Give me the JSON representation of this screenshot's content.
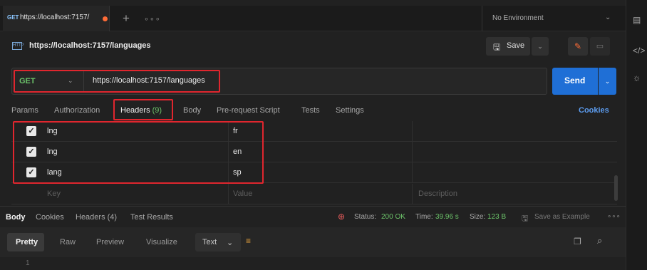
{
  "tab": {
    "method": "GET",
    "title": "https://localhost:7157/"
  },
  "icons": {
    "plus": "+",
    "more": "∘∘∘"
  },
  "environment": {
    "label": "No Environment",
    "chevron": "⌄"
  },
  "request": {
    "icon_label": "HTTP",
    "title": "https://localhost:7157/languages",
    "save_label": "Save"
  },
  "url_bar": {
    "method": "GET",
    "url": "https://localhost:7157/languages",
    "send_label": "Send"
  },
  "request_tabs": [
    {
      "label": "Params"
    },
    {
      "label": "Authorization"
    },
    {
      "label": "Headers",
      "count": "(9)"
    },
    {
      "label": "Body"
    },
    {
      "label": "Pre-request Script"
    },
    {
      "label": "Tests"
    },
    {
      "label": "Settings"
    }
  ],
  "cookies_label": "Cookies",
  "headers": [
    {
      "key": "lng",
      "value": "fr",
      "checked": true
    },
    {
      "key": "lng",
      "value": "en",
      "checked": true
    },
    {
      "key": "lang",
      "value": "sp",
      "checked": true
    }
  ],
  "placeholders": {
    "key": "Key",
    "value": "Value",
    "description": "Description"
  },
  "response_tabs": [
    {
      "label": "Body"
    },
    {
      "label": "Cookies"
    },
    {
      "label": "Headers (4)"
    },
    {
      "label": "Test Results"
    }
  ],
  "response_status": {
    "status_label": "Status:",
    "status_value": "200 OK",
    "time_label": "Time:",
    "time_value": "39.96 s",
    "size_label": "Size:",
    "size_value": "123 B",
    "save_example": "Save as Example",
    "more": "∘∘∘"
  },
  "body_formats": {
    "pretty": "Pretty",
    "raw": "Raw",
    "preview": "Preview",
    "visualize": "Visualize",
    "text": "Text"
  },
  "editor": {
    "line_number": "1"
  },
  "colors": {
    "accent_orange": "#ff6c37",
    "send_blue": "#1f6fd6",
    "get_green": "#6cc36a",
    "highlight_red": "#e0262e",
    "link_blue": "#5c9cef"
  }
}
